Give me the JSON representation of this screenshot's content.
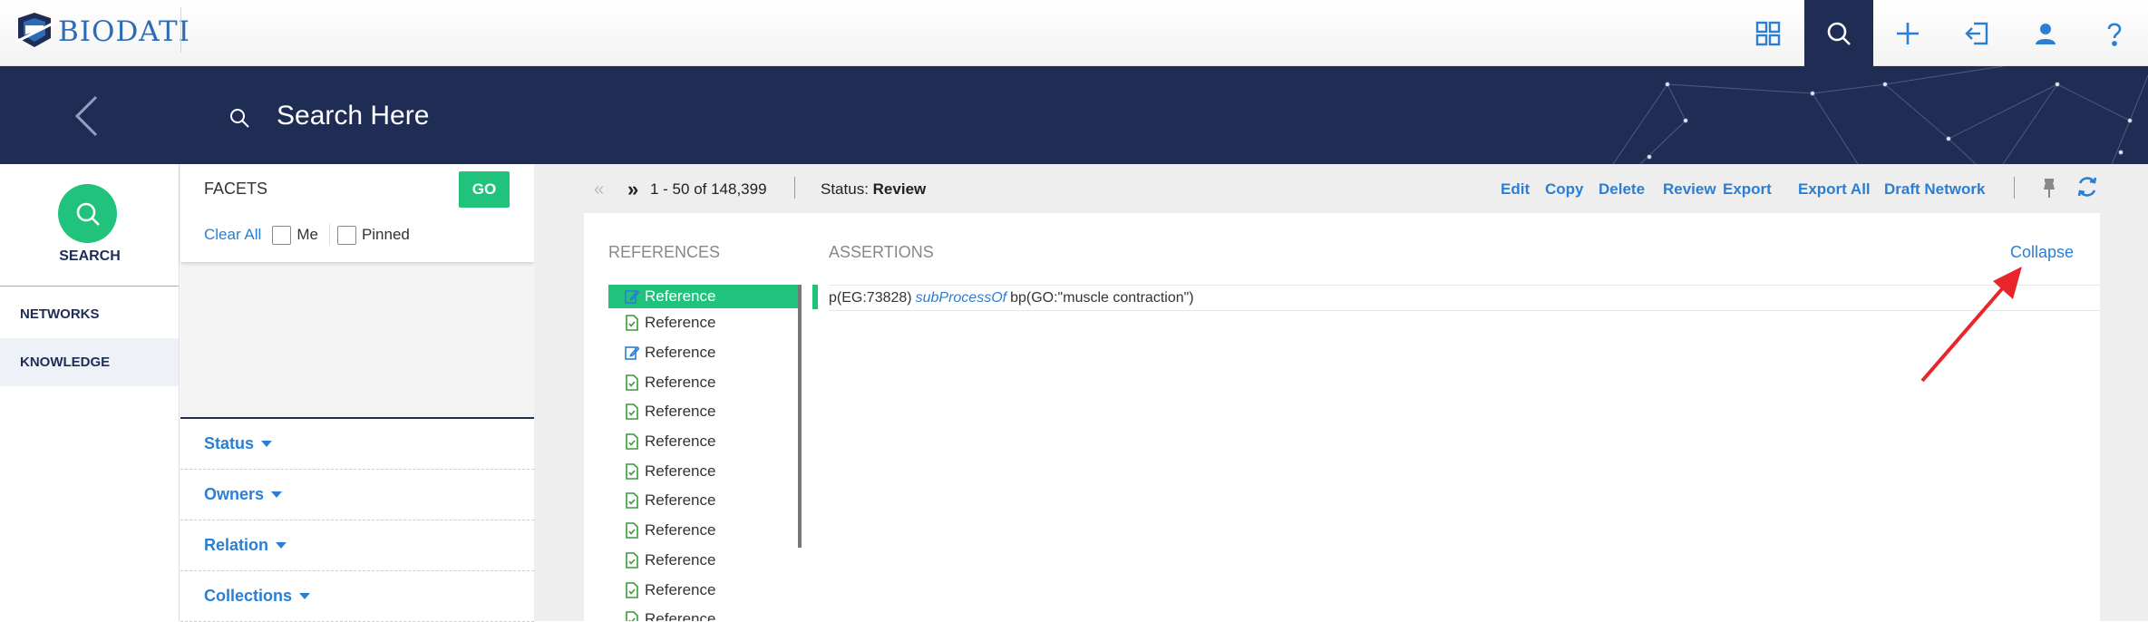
{
  "brand": {
    "logo_text": "BIODATI"
  },
  "topnav": {
    "icons": [
      "grid-icon",
      "search-icon",
      "plus-icon",
      "sign-in-icon",
      "user-icon",
      "help-icon"
    ],
    "active": "search-icon"
  },
  "banner": {
    "search_placeholder": "Search Here"
  },
  "leftnav": {
    "search_label": "SEARCH",
    "items": [
      {
        "label": "NETWORKS",
        "active": false
      },
      {
        "label": "KNOWLEDGE",
        "active": true
      }
    ]
  },
  "facets": {
    "title": "FACETS",
    "go_label": "GO",
    "clear_all": "Clear All",
    "checkboxes": [
      {
        "label": "Me",
        "checked": false
      },
      {
        "label": "Pinned",
        "checked": false
      }
    ],
    "groups": [
      "Status",
      "Owners",
      "Relation",
      "Collections"
    ]
  },
  "toolbar": {
    "prev": "«",
    "next": "»",
    "range": "1 - 50 of 148,399",
    "status_label": "Status:",
    "status_value": "Review",
    "actions": [
      "Edit",
      "Copy",
      "Delete",
      "Review",
      "Export",
      "Export All",
      "Draft Network"
    ]
  },
  "panel": {
    "references_header": "REFERENCES",
    "assertions_header": "ASSERTIONS",
    "collapse_label": "Collapse",
    "references": [
      {
        "label": "Reference",
        "icon": "edit-icon",
        "selected": true
      },
      {
        "label": "Reference",
        "icon": "doc-check-icon",
        "selected": false
      },
      {
        "label": "Reference",
        "icon": "edit-icon",
        "selected": false
      },
      {
        "label": "Reference",
        "icon": "doc-check-icon",
        "selected": false
      },
      {
        "label": "Reference",
        "icon": "doc-check-icon",
        "selected": false
      },
      {
        "label": "Reference",
        "icon": "doc-check-icon",
        "selected": false
      },
      {
        "label": "Reference",
        "icon": "doc-check-icon",
        "selected": false
      },
      {
        "label": "Reference",
        "icon": "doc-check-icon",
        "selected": false
      },
      {
        "label": "Reference",
        "icon": "doc-check-icon",
        "selected": false
      },
      {
        "label": "Reference",
        "icon": "doc-check-icon",
        "selected": false
      },
      {
        "label": "Reference",
        "icon": "doc-check-icon",
        "selected": false
      },
      {
        "label": "Reference",
        "icon": "doc-check-icon",
        "selected": false
      }
    ],
    "assertion": {
      "subject": "p(EG:73828)",
      "relation": "subProcessOf",
      "object": "bp(GO:\"muscle contraction\")"
    }
  },
  "colors": {
    "navy": "#1f2d54",
    "green": "#20c27c",
    "link_blue": "#2a7fd4",
    "arrow_red": "#e8252a"
  }
}
